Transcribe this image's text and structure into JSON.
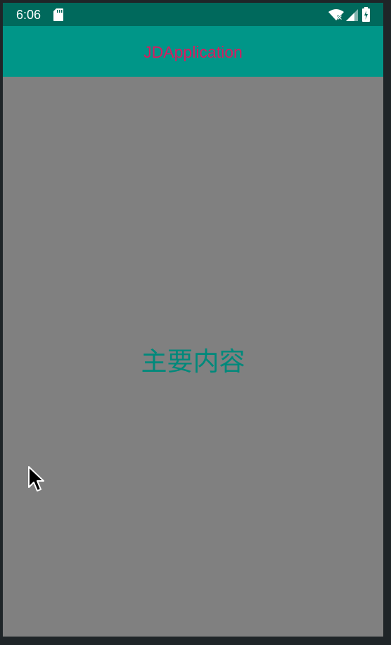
{
  "status_bar": {
    "time": "6:06",
    "icons": [
      "sd-card-icon",
      "wifi-off-icon",
      "cellular-signal-icon",
      "battery-icon"
    ]
  },
  "app_bar": {
    "title": "JDApplication"
  },
  "main": {
    "content_text": "主要内容"
  },
  "colors": {
    "status_bar_bg": "#00695c",
    "app_bar_bg": "#009688",
    "title_color": "#d81b60",
    "content_bg": "#808080",
    "content_text_color": "#00897b"
  }
}
